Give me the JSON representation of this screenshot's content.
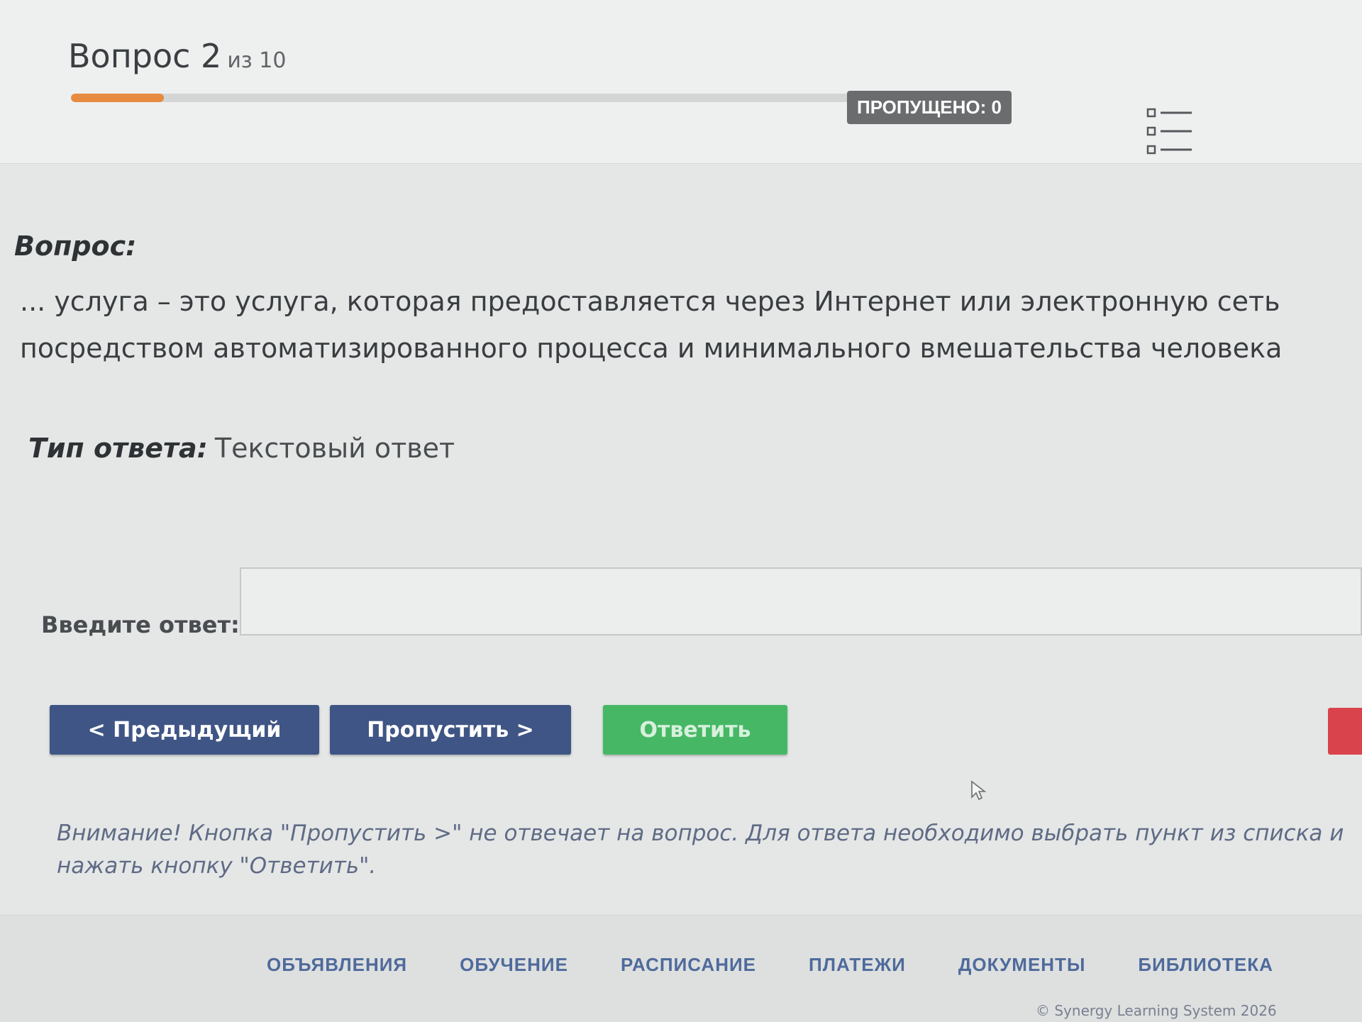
{
  "header": {
    "question_label": "Вопрос 2",
    "question_of": "из 10",
    "progress_fraction": 0.1,
    "skipped_badge": "ПРОПУЩЕНО: 0",
    "list_icon": "question-list-icon"
  },
  "question": {
    "label": "Вопрос:",
    "text": "... услуга – это услуга, которая предоставляется через Интернет или электронную сеть посредством автоматизированного процесса и минимального вмешательства человека",
    "answer_type_label": "Тип ответа:",
    "answer_type_value": "Текстовый ответ"
  },
  "answer": {
    "label": "Введите ответ:",
    "value": "",
    "placeholder": ""
  },
  "buttons": {
    "prev": "< Предыдущий",
    "skip": "Пропустить >",
    "answer": "Ответить"
  },
  "notice": "Внимание! Кнопка \"Пропустить >\" не отвечает на вопрос. Для ответа необходимо выбрать пункт из списка и нажать кнопку \"Ответить\".",
  "footer": {
    "nav": [
      "ОБЪЯВЛЕНИЯ",
      "ОБУЧЕНИЕ",
      "РАСПИСАНИЕ",
      "ПЛАТЕЖИ",
      "ДОКУМЕНТЫ",
      "БИБЛИОТЕКА"
    ],
    "copyright": "© Synergy Learning System 2026"
  },
  "colors": {
    "progress": "#e68b3f",
    "nav_button": "#3f5585",
    "answer_button": "#46b865",
    "danger": "#d9434b",
    "footer_link": "#4f6a9c"
  }
}
